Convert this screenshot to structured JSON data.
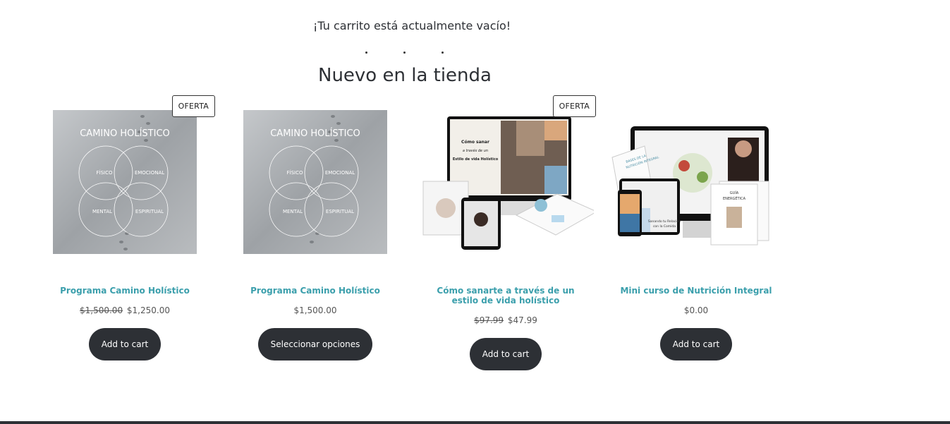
{
  "cart": {
    "empty_message": "¡Tu carrito está actualmente vacío!"
  },
  "section": {
    "title": "Nuevo en la tienda"
  },
  "products": [
    {
      "title": "Programa Camino Holístico",
      "badge": "OFERTA",
      "old_price": "$1,500.00",
      "price": "$1,250.00",
      "button": "Add to cart",
      "image_text": {
        "heading": "CAMINO HOLÍSTICO",
        "q1": "FÍSICO",
        "q2": "EMOCIONAL",
        "q3": "MENTAL",
        "q4": "ESPIRITUAL"
      }
    },
    {
      "title": "Programa Camino Holístico",
      "price": "$1,500.00",
      "button": "Seleccionar opciones",
      "image_text": {
        "heading": "CAMINO HOLÍSTICO",
        "q1": "FÍSICO",
        "q2": "EMOCIONAL",
        "q3": "MENTAL",
        "q4": "ESPIRITUAL"
      }
    },
    {
      "title": "Cómo sanarte a través de un estilo de vida holístico",
      "badge": "OFERTA",
      "old_price": "$97.99",
      "price": "$47.99",
      "button": "Add to cart",
      "image_text": {
        "screen": "Cómo sanar a través de un Estilo de vida Holístico"
      }
    },
    {
      "title": "Mini curso de Nutrición Integral",
      "price": "$0.00",
      "button": "Add to cart",
      "image_text": {
        "booklet1": "BASES DE LA NUTRICIÓN INTEGRAL",
        "tablet": "Sanando tu Relación con la Comida",
        "booklet2": "GUÍA ENERGÉTICA"
      }
    }
  ],
  "colors": {
    "accent": "#3b9fac",
    "button": "#2d3035"
  }
}
